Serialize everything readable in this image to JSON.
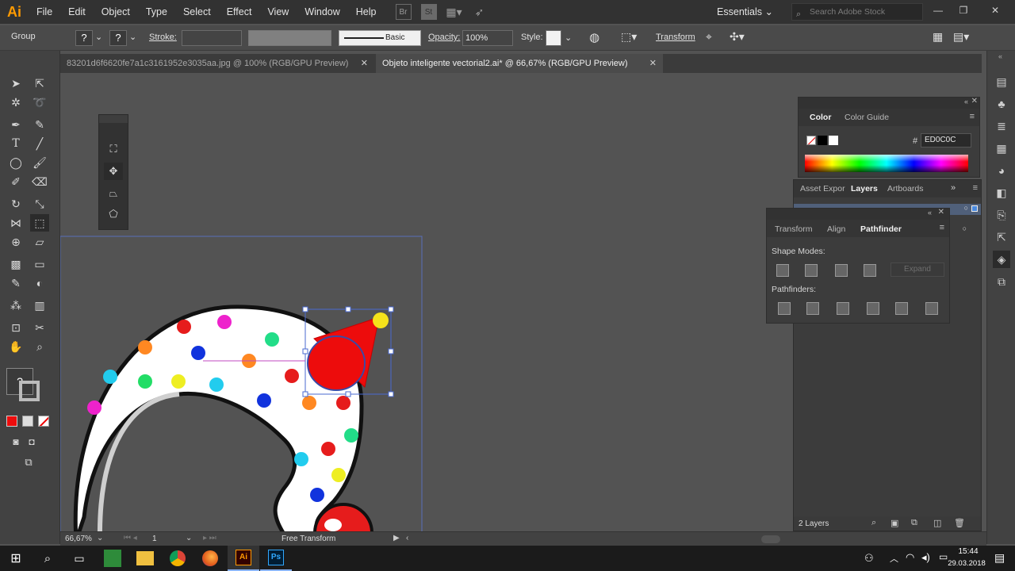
{
  "app": {
    "logo": "Ai"
  },
  "menu": [
    "File",
    "Edit",
    "Object",
    "Type",
    "Select",
    "Effect",
    "View",
    "Window",
    "Help"
  ],
  "menubar": {
    "br_label": "Br",
    "st_label": "St",
    "workspace": "Essentials",
    "search_placeholder": "Search Adobe Stock"
  },
  "control": {
    "selection": "Group",
    "stroke_label": "Stroke:",
    "brush": "Basic",
    "opacity_label": "Opacity:",
    "opacity": "100%",
    "style_label": "Style:",
    "transform_link": "Transform"
  },
  "tabs": [
    {
      "label": "83201d6f6620fe7a1c3161952e3035aa.jpg @ 100% (RGB/GPU Preview)",
      "active": false
    },
    {
      "label": "Objeto inteligente vectorial2.ai* @ 66,67% (RGB/GPU Preview)",
      "active": true
    }
  ],
  "color_panel": {
    "tabs": [
      "Color",
      "Color Guide"
    ],
    "hash": "#",
    "hex": "ED0C0C"
  },
  "layers_panel": {
    "tabs": [
      "Asset Expor",
      "Layers",
      "Artboards"
    ],
    "count": "2 Layers"
  },
  "pathfinder_panel": {
    "tabs": [
      "Transform",
      "Align",
      "Pathfinder"
    ],
    "shape_modes": "Shape Modes:",
    "expand": "Expand",
    "pathfinders": "Pathfinders:"
  },
  "status": {
    "zoom": "66,67%",
    "artboard": "1",
    "tool": "Free Transform"
  },
  "taskbar": {
    "time": "15:44",
    "date": "29.03.2018"
  },
  "colors": {
    "fill": "#ED0C0C",
    "accent": "#ff9a00"
  }
}
